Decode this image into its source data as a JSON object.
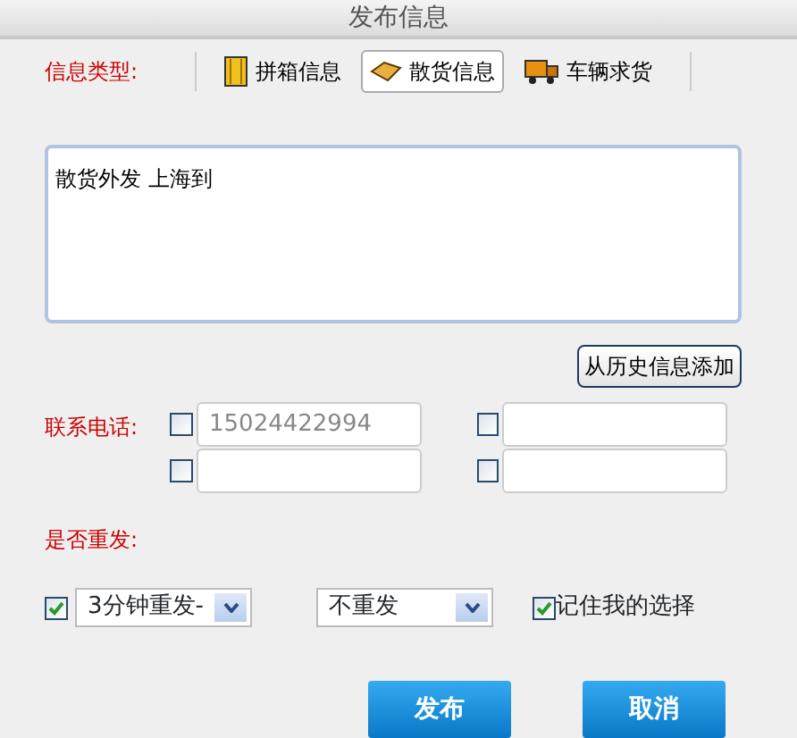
{
  "window": {
    "title": "发布信息"
  },
  "info_type": {
    "label": "信息类型:",
    "tabs": [
      {
        "label": "拼箱信息",
        "kind": "box",
        "selected": false
      },
      {
        "label": "散货信息",
        "kind": "parcel",
        "selected": true
      },
      {
        "label": "车辆求货",
        "kind": "truck",
        "selected": false
      }
    ]
  },
  "message": {
    "value": "散货外发 上海到"
  },
  "history_button": "从历史信息添加",
  "phones": {
    "label": "联系电话:",
    "fields": [
      {
        "placeholder": "15024422994",
        "checked": false
      },
      {
        "checked": false
      },
      {
        "checked": false
      },
      {
        "checked": false
      }
    ]
  },
  "repeat": {
    "label": "是否重发:",
    "enabled": {
      "checked": true
    },
    "interval": {
      "value": "3分钟重发-"
    },
    "limit": {
      "value": "不重发"
    },
    "remember": {
      "label": "记住我的选择",
      "checked": true
    }
  },
  "buttons": [
    "发布",
    "取消"
  ]
}
